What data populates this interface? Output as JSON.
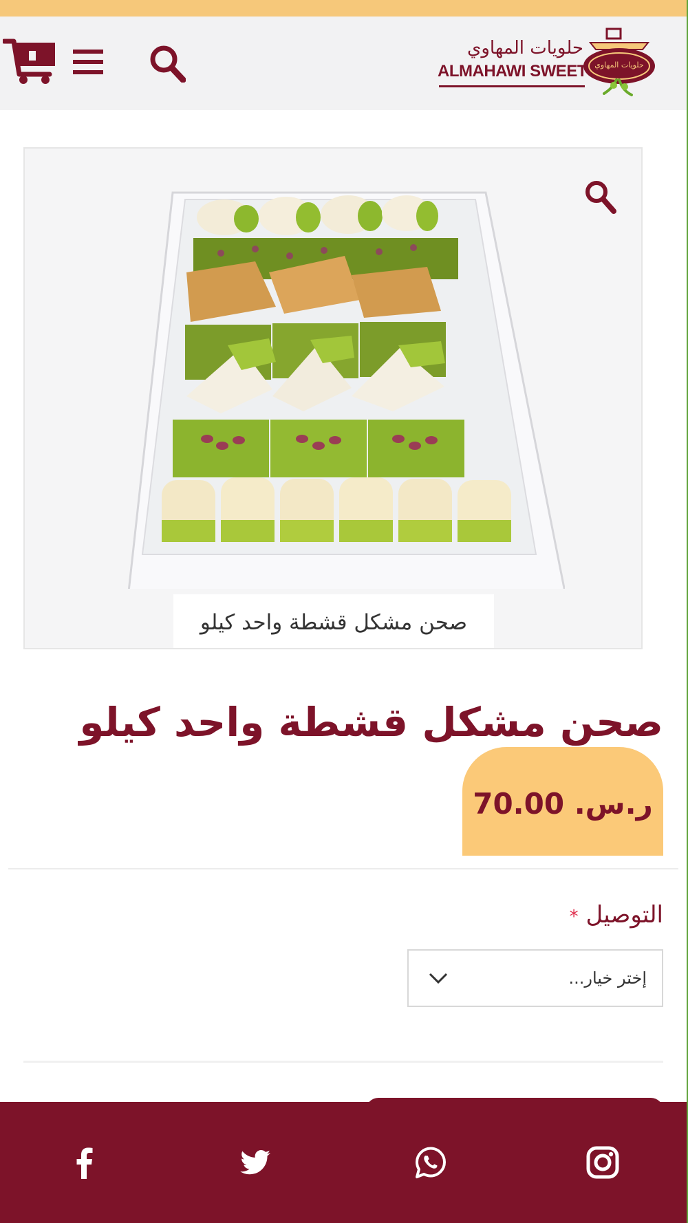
{
  "header": {
    "logo": {
      "arabic_name": "حلويات المهاوي",
      "english_name": "ALMAHAWI SWEETS",
      "emblem_text": "حلويات المهاوي"
    },
    "icons": {
      "cart": "cart-icon",
      "menu": "hamburger-menu-icon",
      "search": "search-icon"
    }
  },
  "gallery": {
    "caption": "صحن مشكل قشطة واحد كيلو",
    "zoom_icon": "zoom-icon"
  },
  "product": {
    "title": "صحن مشكل قشطة واحد كيلو",
    "price": "ر.س. 70.00"
  },
  "options": {
    "delivery_label": "التوصيل",
    "required_mark": "*",
    "select_placeholder": "إختر خيار..."
  },
  "footer": {
    "social_icons": [
      "facebook-icon",
      "twitter-icon",
      "whatsapp-icon",
      "instagram-icon"
    ]
  },
  "colors": {
    "brand": "#7d1329",
    "accent": "#fbc978",
    "header_bg": "#f2f2f3",
    "top_stripe": "#f6c87a"
  }
}
